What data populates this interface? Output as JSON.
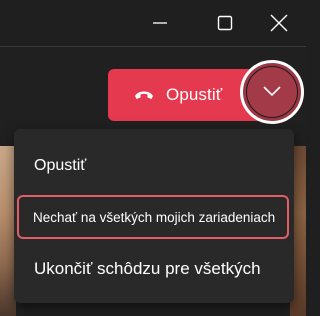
{
  "window": {
    "controls": [
      "minimize-icon",
      "maximize-icon",
      "close-icon"
    ]
  },
  "meeting": {
    "leave_button": {
      "label": "Opustiť",
      "icon": "phone-hangup-icon",
      "color": "#e5394f"
    },
    "leave_options_button": {
      "icon": "chevron-down-icon"
    }
  },
  "leave_menu": {
    "items": [
      {
        "label": "Opustiť"
      },
      {
        "label": "Nechať na všetkých mojich zariadeniach",
        "highlighted": true
      },
      {
        "label": "Ukončiť schôdzu pre všetkých"
      }
    ],
    "highlight_color": "#e15e66"
  }
}
